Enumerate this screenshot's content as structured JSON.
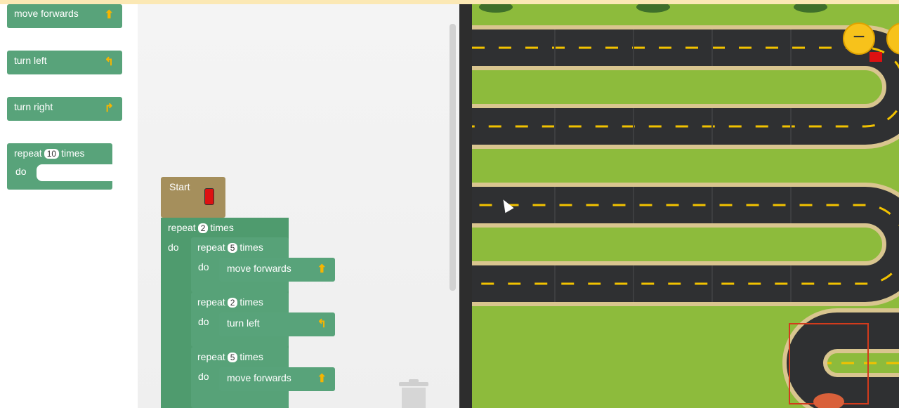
{
  "toolbox": {
    "move_forwards": "move forwards",
    "turn_left": "turn left",
    "turn_right": "turn right",
    "repeat_word": "repeat",
    "repeat_count": "10",
    "times_word": "times",
    "do_word": "do"
  },
  "program": {
    "start_label": "Start",
    "outer": {
      "repeat": "repeat",
      "count": "2",
      "times": "times",
      "do": "do"
    },
    "inner1": {
      "repeat": "repeat",
      "count": "5",
      "times": "times",
      "do": "do",
      "action": "move forwards"
    },
    "inner2": {
      "repeat": "repeat",
      "count": "2",
      "times": "times",
      "do": "do",
      "action": "turn left"
    },
    "inner3": {
      "repeat": "repeat",
      "count": "5",
      "times": "times",
      "do": "do",
      "action": "move forwards"
    }
  },
  "map": {
    "zoom_out_icon": "minus-icon",
    "colors": {
      "grass": "#8dbb3c",
      "road": "#2f3032",
      "road_edge": "#d9c58f",
      "lane": "#f2c200",
      "highlight": "#d23b1c"
    }
  }
}
